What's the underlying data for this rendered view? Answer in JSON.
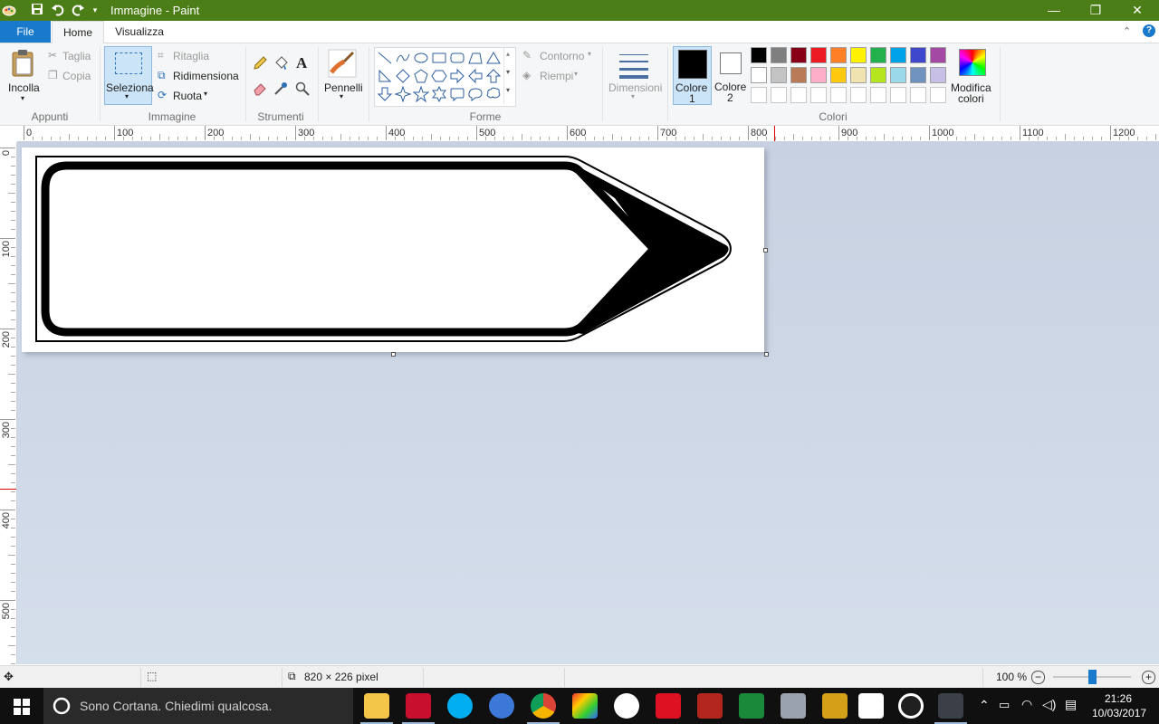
{
  "window": {
    "title": "Immagine - Paint",
    "min": "—",
    "max": "❐",
    "close": "✕"
  },
  "tabs": {
    "file": "File",
    "home": "Home",
    "view": "Visualizza"
  },
  "ribbon": {
    "clipboard": {
      "group": "Appunti",
      "paste": "Incolla",
      "cut": "Taglia",
      "copy": "Copia"
    },
    "image": {
      "group": "Immagine",
      "select": "Seleziona",
      "crop": "Ritaglia",
      "resize": "Ridimensiona",
      "rotate": "Ruota"
    },
    "tools": {
      "group": "Strumenti"
    },
    "brushes": {
      "label": "Pennelli"
    },
    "shapes": {
      "group": "Forme",
      "outline": "Contorno",
      "fill": "Riempi"
    },
    "size": {
      "label": "Dimensioni"
    },
    "colors": {
      "group": "Colori",
      "color1": "Colore",
      "color1_n": "1",
      "color2": "Colore",
      "color2_n": "2",
      "edit1": "Modifica",
      "edit2": "colori",
      "current1": "#000000",
      "current2": "#ffffff",
      "row1": [
        "#000000",
        "#7f7f7f",
        "#880015",
        "#ed1c24",
        "#ff7f27",
        "#fff200",
        "#22b14c",
        "#00a2e8",
        "#3f48cc",
        "#a349a4"
      ],
      "row2": [
        "#ffffff",
        "#c3c3c3",
        "#b97a57",
        "#ffaec9",
        "#ffc90e",
        "#efe4b0",
        "#b5e61d",
        "#99d9ea",
        "#7092be",
        "#c8bfe7"
      ]
    }
  },
  "rulers": {
    "h": [
      "0",
      "100",
      "200",
      "300",
      "400",
      "500",
      "600",
      "700",
      "800",
      "900",
      "1000",
      "1100",
      "1200"
    ],
    "v": [
      "0",
      "100",
      "200",
      "300",
      "400",
      "500"
    ]
  },
  "status": {
    "size": "820 × 226 pixel",
    "zoom": "100 %",
    "zoom_minus": "−",
    "zoom_plus": "+"
  },
  "taskbar": {
    "cortana": "Sono Cortana. Chiedimi qualcosa.",
    "time": "21:26",
    "date": "10/03/2017"
  }
}
